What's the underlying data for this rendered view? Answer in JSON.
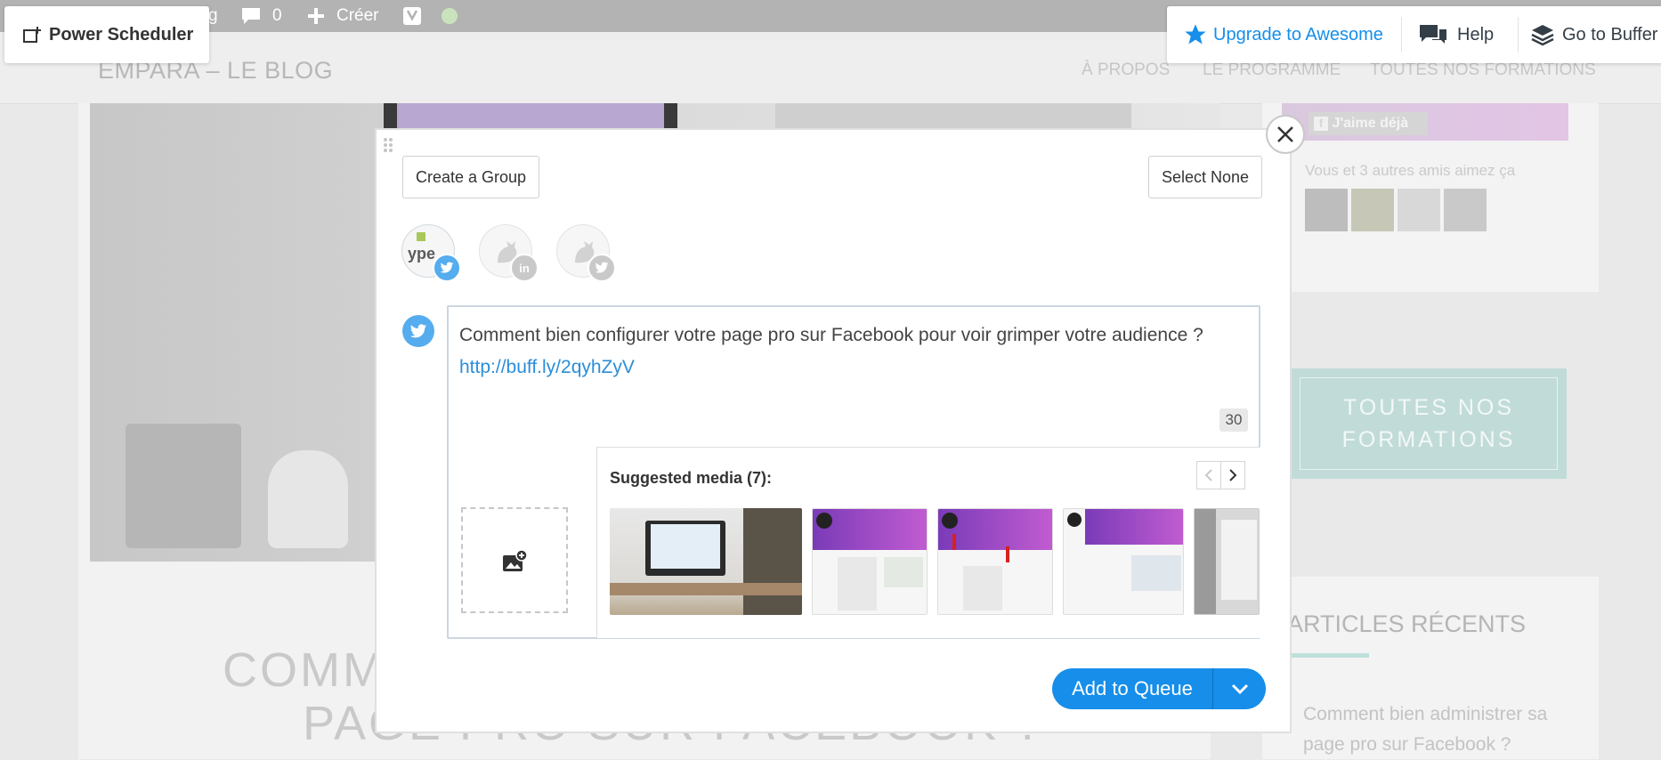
{
  "admin_bar": {
    "fragment": "g",
    "comments_count": "0",
    "create_label": "Créer"
  },
  "site": {
    "title": "EMPARA – LE BLOG",
    "nav": [
      "À PROPOS",
      "LE PROGRAMME",
      "TOUTES NOS FORMATIONS"
    ]
  },
  "article": {
    "title_line1": "COMM",
    "title_line2": "PAGE PRO SUR FACEBOOK ?"
  },
  "sidebar": {
    "fb_like_button": "J'aime déjà",
    "fb_friends_text": "Vous et 3 autres amis aimez ça",
    "formations_button": "TOUTES NOS FORMATIONS",
    "recent_heading": "ARTICLES RÉCENTS",
    "recent_link": "Comment bien administrer sa page pro sur Facebook ?"
  },
  "buffer_bar": {
    "power_scheduler": "Power Scheduler",
    "upgrade": "Upgrade to Awesome",
    "help": "Help",
    "go_to_buffer": "Go to Buffer"
  },
  "composer": {
    "create_group": "Create a Group",
    "select_none": "Select None",
    "profiles": [
      {
        "name": "ype-twitter",
        "network": "twitter",
        "selected": true
      },
      {
        "name": "rooster-linkedin",
        "network": "linkedin",
        "selected": false
      },
      {
        "name": "rooster-twitter",
        "network": "twitter",
        "selected": false
      }
    ],
    "text": "Comment bien configurer votre page pro sur Facebook pour voir grimper votre audience ?",
    "link": "http://buff.ly/2qyhZyV",
    "char_count": "30",
    "suggested_media_label": "Suggested media (7):",
    "add_to_queue": "Add to Queue"
  },
  "colors": {
    "buffer_blue": "#168eea",
    "twitter_blue": "#55acee",
    "link_blue": "#2b8ed9"
  }
}
